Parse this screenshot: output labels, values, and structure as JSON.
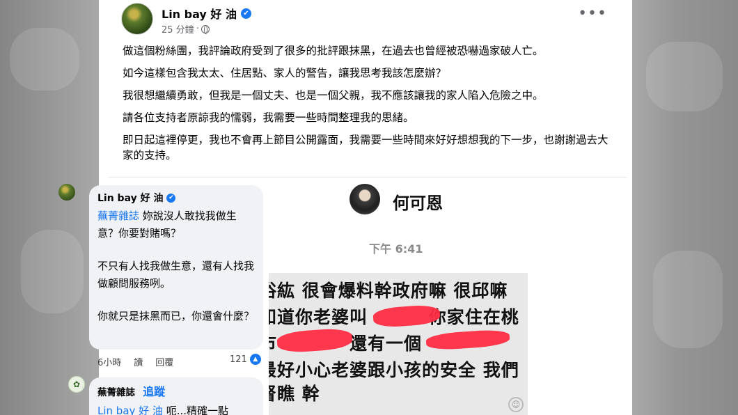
{
  "post": {
    "author": "Lin bay 好 油",
    "timestamp": "25 分鐘",
    "separator": "·",
    "paragraphs": [
      "做這個粉絲團，我評論政府受到了很多的批評跟抹黑，在過去也曾經被恐嚇過家破人亡。",
      "如今這樣包含我太太、住居點、家人的警告，讓我思考我該怎麼辦？",
      "我很想繼續勇敢，但我是一個丈夫、也是一個父親，我不應該讓我的家人陷入危險之中。",
      "請各位支持者原諒我的懦弱，我需要一些時間整理我的思緒。",
      "即日起這裡停更，我也不會再上節目公開露面，我需要一些時間來好好想想我的下一步，也謝謝過去大家的支持。"
    ],
    "verified_icon": "✔",
    "more_icon": "•••"
  },
  "comment": {
    "author": "Lin bay 好 油",
    "mention": "蕪菁雜誌",
    "line1_rest": " 妳說沒人敢找我做生意？你要對賭嗎？",
    "line2": "不只有人找我做生意，還有人找我做顧問服務咧。",
    "line3": "你就只是抹黑而已，你還會什麼？",
    "time": "6小時",
    "read": "讀",
    "reply": "回覆",
    "likes": "121",
    "like_icon": "👍"
  },
  "reply": {
    "author": "蕪菁雜誌",
    "follow": "追蹤",
    "mention": "Lin bay 好 油",
    "text": " 呃...精確一點"
  },
  "chat": {
    "contact_name": "何可恩",
    "time": "下午 6:41",
    "lines": [
      "浴紘 很會爆料幹政府嘛 很邱嘛",
      "知道你老婆叫　　　 你家住在桃",
      "市　　　　還有一個",
      "最好小心老婆跟小孩的安全 我們",
      "督瞧 幹"
    ],
    "redaction_color": "#ff2d44"
  }
}
